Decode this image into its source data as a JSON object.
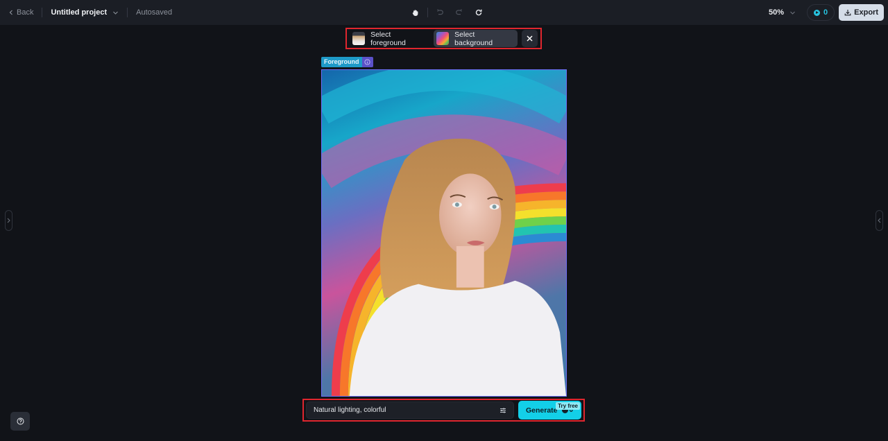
{
  "topbar": {
    "back_label": "Back",
    "project_title": "Untitled project",
    "save_status": "Autosaved",
    "tools": [
      "hand-icon",
      "undo-icon",
      "redo-icon",
      "refresh-icon"
    ],
    "zoom_level": "50%",
    "credits_count": "0",
    "export_label": "Export"
  },
  "selector": {
    "foreground_label": "Select foreground",
    "background_label": "Select background",
    "active": "background"
  },
  "canvas": {
    "layer_tag": "Foreground",
    "image_description": "Woman with blonde hair in white top in front of colorful rainbow background"
  },
  "prompt": {
    "value": "Natural lighting, colorful",
    "generate_label": "Generate",
    "generate_cost": "0",
    "badge": "Try free"
  },
  "colors": {
    "accent": "#13cfe8",
    "highlight_border": "#e0262e",
    "selection_border": "#6f6ef7",
    "background": "#111318",
    "topbar": "#1b1e25"
  }
}
